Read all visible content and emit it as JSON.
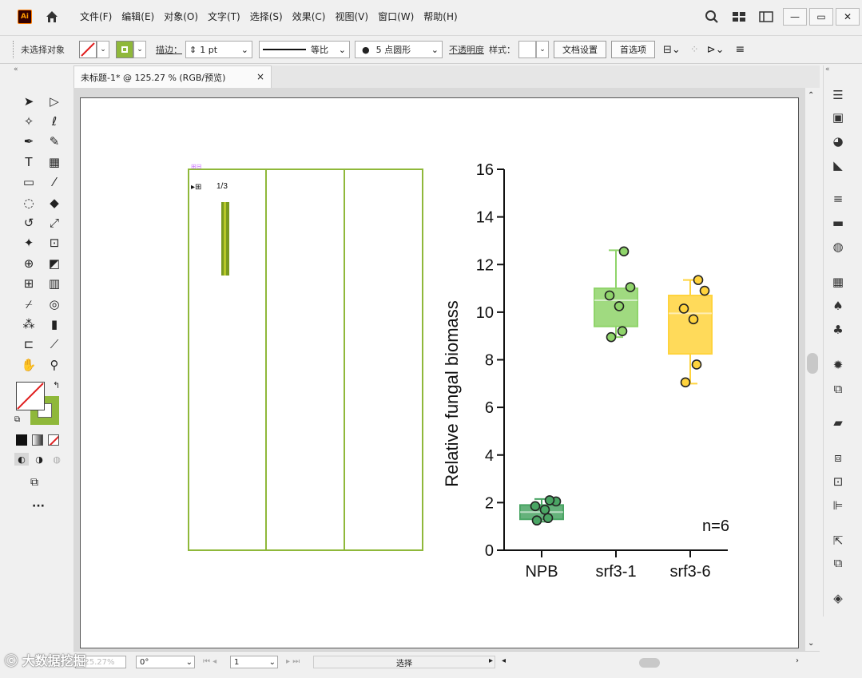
{
  "app": {
    "logo": "Ai",
    "menu": [
      "文件(F)",
      "编辑(E)",
      "对象(O)",
      "文字(T)",
      "选择(S)",
      "效果(C)",
      "视图(V)",
      "窗口(W)",
      "帮助(H)"
    ]
  },
  "control_bar": {
    "no_selection": "未选择对象",
    "stroke_label": "描边：",
    "stroke_value": "1 pt",
    "profile_label": "等比",
    "brush_label": "5 点圆形",
    "opacity_label": "不透明度",
    "style_label": "样式：",
    "doc_setup": "文档设置",
    "preferences": "首选项"
  },
  "document_tab": {
    "title": "未标题-1* @ 125.27 % (RGB/预览)",
    "close": "×"
  },
  "artwork": {
    "placed_label": "1/3",
    "panels": 3,
    "panel_color": "#8fb83a"
  },
  "chart_data": {
    "type": "box",
    "categories": [
      "NPB",
      "srf3-1",
      "srf3-6"
    ],
    "ylabel": "Relative fungal biomass",
    "xlabel": "",
    "ylim": [
      0,
      16
    ],
    "yticks": [
      0,
      2,
      4,
      6,
      8,
      10,
      12,
      14,
      16
    ],
    "annotation": "n=6",
    "series": [
      {
        "name": "NPB",
        "color": "#4aa564",
        "min": 1.2,
        "q1": 1.3,
        "median": 1.6,
        "q3": 1.9,
        "max": 2.15,
        "points": [
          1.25,
          1.35,
          1.7,
          1.85,
          2.05,
          2.1
        ]
      },
      {
        "name": "srf3-1",
        "color": "#8fd46a",
        "min": 8.95,
        "q1": 9.4,
        "median": 10.5,
        "q3": 11.0,
        "max": 12.6,
        "points": [
          8.95,
          9.2,
          10.25,
          10.7,
          11.05,
          12.55
        ]
      },
      {
        "name": "srf3-6",
        "color": "#ffd33d",
        "min": 7.0,
        "q1": 8.25,
        "median": 9.95,
        "q3": 10.7,
        "max": 11.35,
        "points": [
          7.05,
          7.8,
          9.7,
          10.15,
          10.9,
          11.35
        ]
      }
    ]
  },
  "status_bar": {
    "zoom": "125.27%",
    "rotate": "0°",
    "artboard": "1",
    "mode": "选择",
    "nav_prev": "◂",
    "nav_next": "▸"
  },
  "watermark": "大数据挖掘",
  "colors": {
    "artboard_border": "#555555",
    "accent_green": "#8fb83a"
  }
}
